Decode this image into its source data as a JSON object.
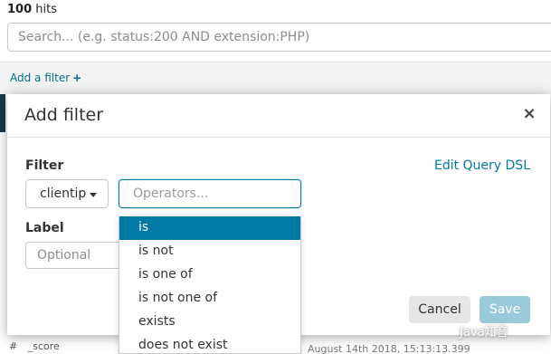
{
  "results": {
    "count": "100",
    "hits_label": "hits"
  },
  "search": {
    "placeholder": "Search... (e.g. status:200 AND extension:PHP)"
  },
  "filter_bar": {
    "add_filter_label": "Add a filter",
    "add_icon": "+"
  },
  "modal": {
    "title": "Add filter",
    "close_icon": "×",
    "filter_label": "Filter",
    "edit_dsl_link": "Edit Query DSL",
    "field_value": "clientip",
    "operator_placeholder": "Operators...",
    "label_heading": "Label",
    "label_placeholder": "Optional",
    "cancel_label": "Cancel",
    "save_label": "Save"
  },
  "operators": [
    {
      "label": "is",
      "selected": true
    },
    {
      "label": "is not",
      "selected": false
    },
    {
      "label": "is one of",
      "selected": false
    },
    {
      "label": "is not one of",
      "selected": false
    },
    {
      "label": "exists",
      "selected": false
    },
    {
      "label": "does not exist",
      "selected": false
    }
  ],
  "table": {
    "hash": "#",
    "score_column": "_score",
    "date_partial": "August 14th 2018, 15:13:13.399"
  },
  "watermark": "Java知音",
  "colors": {
    "accent": "#0079a5",
    "save_disabled": "#9ac9dc",
    "link": "#006e8a"
  }
}
